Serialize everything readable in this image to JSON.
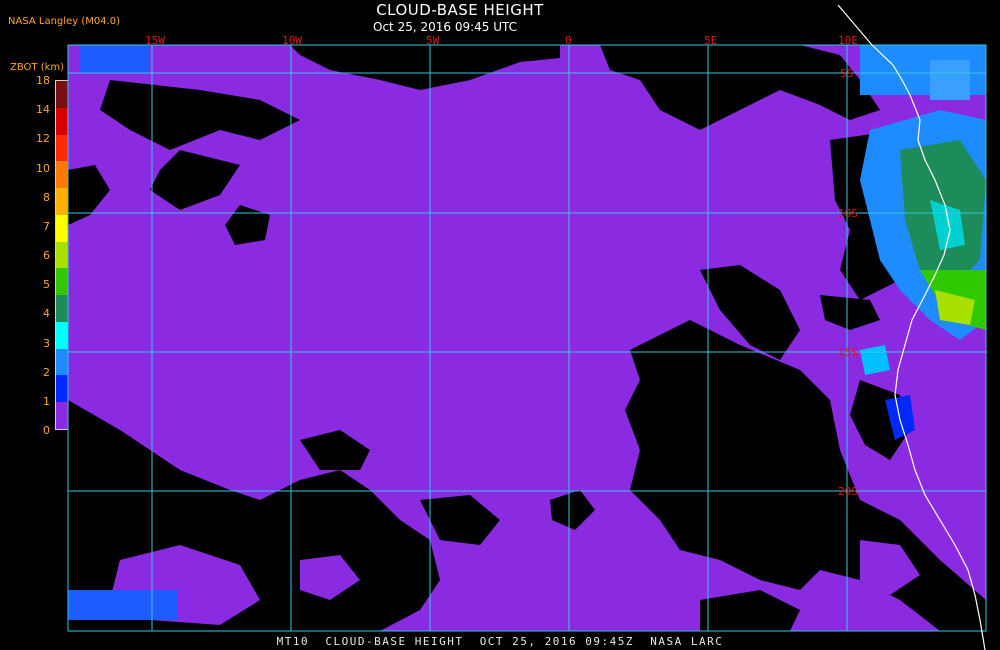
{
  "header": {
    "title": "CLOUD-BASE HEIGHT",
    "subtitle": "Oct 25, 2016 09:45 UTC",
    "producer": "NASA Langley (M04.0)"
  },
  "colorbar": {
    "units": "ZBOT (km)",
    "ticks": [
      "18",
      "14",
      "12",
      "10",
      "8",
      "7",
      "6",
      "5",
      "4",
      "3",
      "2",
      "1",
      "0"
    ],
    "colors": [
      "#7a0f0f",
      "#d80000",
      "#ff2a00",
      "#ff7800",
      "#ffb000",
      "#ffff00",
      "#a8e000",
      "#30c800",
      "#1e8c5a",
      "#00ffff",
      "#1e8cff",
      "#0028ff",
      "#8a2be2"
    ]
  },
  "map": {
    "lon_labels": [
      "15W",
      "10W",
      "5W",
      "0",
      "5E",
      "10E"
    ],
    "lat_labels": [
      "5S",
      "10S",
      "15S",
      "20S"
    ],
    "colors": {
      "grid": "#2fc8e0",
      "coast": "#ffffff",
      "label": "#e01818",
      "low_cloud": "#8a2be2",
      "clear": "#000000"
    }
  },
  "footer": {
    "text": "MT10  CLOUD-BASE HEIGHT  OCT 25, 2016 09:45Z  NASA LARC"
  }
}
